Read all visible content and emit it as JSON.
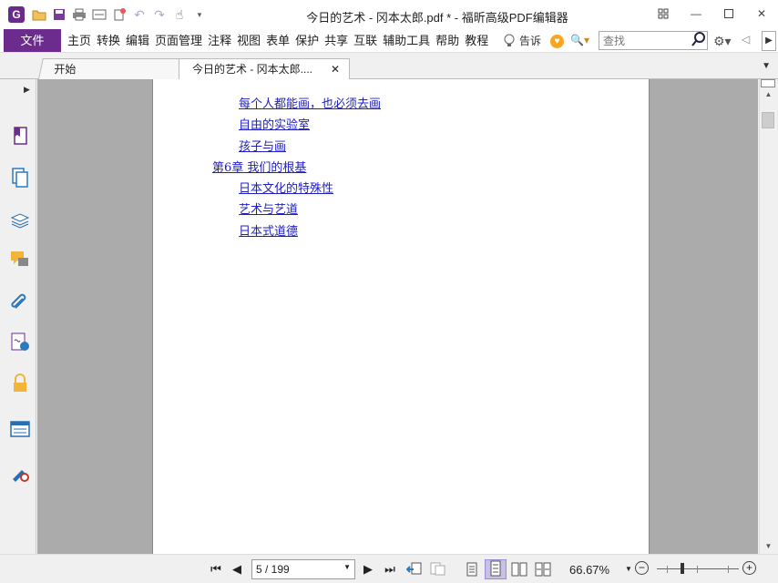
{
  "window": {
    "title": "今日的艺术 - 冈本太郎.pdf * - 福昕高级PDF编辑器",
    "logo_letter": "G"
  },
  "menu": {
    "file": "文件",
    "items": [
      "主页",
      "转换",
      "编辑",
      "页面管理",
      "注释",
      "视图",
      "表单",
      "保护",
      "共享",
      "互联",
      "辅助工具",
      "帮助",
      "教程"
    ],
    "tell_me": "告诉",
    "search_placeholder": "查找"
  },
  "tabs": [
    {
      "label": "开始"
    },
    {
      "label": "今日的艺术 - 冈本太郎...."
    }
  ],
  "toc": [
    {
      "text": "每个人都能画，也必须去画",
      "level": 2
    },
    {
      "text": "自由的实验室",
      "level": 2
    },
    {
      "text": "孩子与画",
      "level": 2
    },
    {
      "text": "第6章 我们的根基",
      "level": 1
    },
    {
      "text": "日本文化的特殊性",
      "level": 2
    },
    {
      "text": "艺术与艺道",
      "level": 2
    },
    {
      "text": "日本式道德",
      "level": 2
    }
  ],
  "statusbar": {
    "page_display": "5 / 199",
    "current_page": 5,
    "total_pages": 199,
    "zoom": "66.67%"
  },
  "left_panel_icons": [
    "bookmark-icon",
    "pages-icon",
    "layers-icon",
    "comments-icon",
    "attachments-icon",
    "signature-icon",
    "security-icon",
    "form-fields-icon",
    "certificate-icon"
  ],
  "colors": {
    "brand": "#6b2c8e",
    "link": "#2020c0",
    "doc_background": "#ababab"
  }
}
